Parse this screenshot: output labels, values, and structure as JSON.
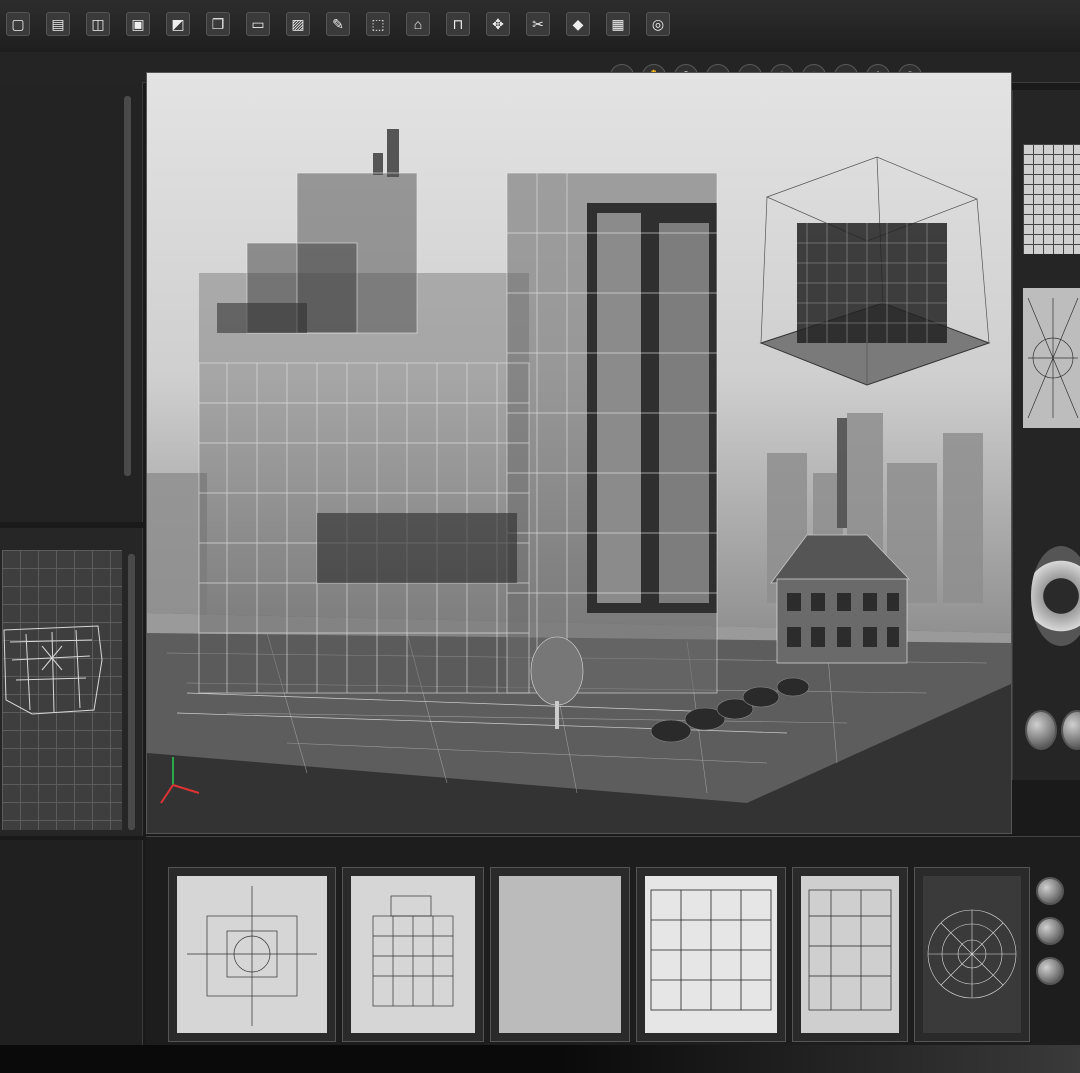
{
  "toolbar": {
    "tools": [
      {
        "icon": "page-icon",
        "glyph": "▢"
      },
      {
        "icon": "open-icon",
        "glyph": "▤"
      },
      {
        "icon": "layers-icon",
        "glyph": "◫"
      },
      {
        "icon": "save-icon",
        "glyph": "▣"
      },
      {
        "icon": "select-icon",
        "glyph": "◩"
      },
      {
        "icon": "copy-icon",
        "glyph": "❐"
      },
      {
        "icon": "frame-icon",
        "glyph": "▭"
      },
      {
        "icon": "photo-icon",
        "glyph": "▨"
      },
      {
        "icon": "paint-icon",
        "glyph": "✎"
      },
      {
        "icon": "box-icon",
        "glyph": "⬚"
      },
      {
        "icon": "arch-icon",
        "glyph": "⌂"
      },
      {
        "icon": "stair-icon",
        "glyph": "⊓"
      },
      {
        "icon": "move-icon",
        "glyph": "✥"
      },
      {
        "icon": "cut-icon",
        "glyph": "✂"
      },
      {
        "icon": "shape-icon",
        "glyph": "◆"
      },
      {
        "icon": "render-icon",
        "glyph": "▦"
      },
      {
        "icon": "camera-icon",
        "glyph": "◎"
      }
    ],
    "secondary": [
      {
        "icon": "orbit-icon",
        "glyph": "◌"
      },
      {
        "icon": "pan-icon",
        "glyph": "✋"
      },
      {
        "icon": "zoom-icon",
        "glyph": "⚲"
      },
      {
        "icon": "view-icon",
        "glyph": "◉"
      },
      {
        "icon": "grid-icon",
        "glyph": "⊞"
      },
      {
        "icon": "light-icon",
        "glyph": "☀"
      },
      {
        "icon": "snap-icon",
        "glyph": "⊹"
      },
      {
        "icon": "measure-icon",
        "glyph": "⟷"
      },
      {
        "icon": "settings-icon",
        "glyph": "⚙"
      },
      {
        "icon": "help-icon",
        "glyph": "?"
      }
    ]
  },
  "colors": {
    "panel_bg": "#232323",
    "viewport_top": "#e3e3e3",
    "viewport_bottom": "#3a3a3a",
    "line": "#3c3c3c"
  }
}
